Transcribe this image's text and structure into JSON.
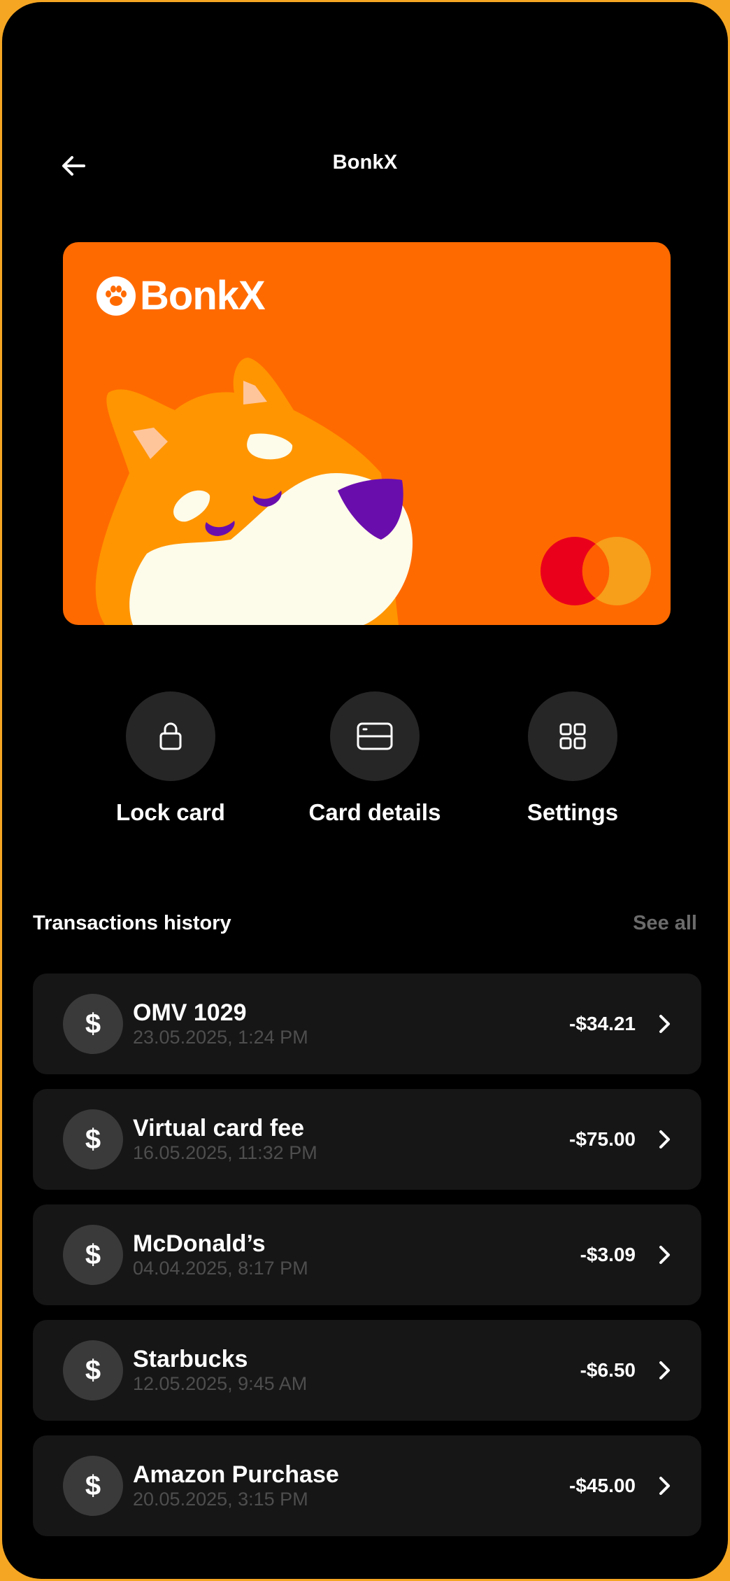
{
  "header": {
    "title": "BonkX",
    "back_icon": "arrow-left-icon"
  },
  "card": {
    "brand": "BonkX",
    "logo_icon": "paw-icon",
    "network": "mastercard",
    "color": "#FF6A00"
  },
  "actions": [
    {
      "label": "Lock card",
      "icon": "lock-icon"
    },
    {
      "label": "Card details",
      "icon": "card-icon"
    },
    {
      "label": "Settings",
      "icon": "grid-icon"
    }
  ],
  "transactions": {
    "title": "Transactions history",
    "see_all": "See all",
    "items": [
      {
        "icon": "$",
        "name": "OMV 1029",
        "date": "23.05.2025, 1:24 PM",
        "amount": "-$34.21"
      },
      {
        "icon": "$",
        "name": "Virtual card fee",
        "date": "16.05.2025, 11:32 PM",
        "amount": "-$75.00"
      },
      {
        "icon": "$",
        "name": "McDonald’s",
        "date": "04.04.2025, 8:17 PM",
        "amount": "-$3.09"
      },
      {
        "icon": "$",
        "name": "Starbucks",
        "date": "12.05.2025, 9:45 AM",
        "amount": "-$6.50"
      },
      {
        "icon": "$",
        "name": "Amazon Purchase",
        "date": "20.05.2025, 3:15 PM",
        "amount": "-$45.00"
      }
    ]
  },
  "colors": {
    "frame": "#F5A623",
    "background": "#000000",
    "card_orange": "#FF6A00",
    "surface": "#161616",
    "muted": "#6B6B6B"
  }
}
